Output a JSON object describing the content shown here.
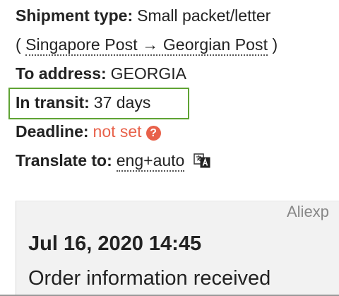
{
  "shipment": {
    "type_label": "Shipment type:",
    "type_value": "Small packet/letter",
    "route_open": "(",
    "route_text": "Singapore Post → Georgian Post",
    "route_close": ")",
    "address_label": "To address:",
    "address_value": "GEORGIA",
    "transit_label": "In transit:",
    "transit_value": "37 days",
    "deadline_label": "Deadline:",
    "deadline_value": "not set",
    "help_glyph": "?",
    "translate_label": "Translate to:",
    "translate_value": "eng+auto"
  },
  "event": {
    "carrier": "Aliexp",
    "date": "Jul 16, 2020 14:45",
    "text": "Order information received"
  },
  "colors": {
    "highlight": "#5fa334",
    "not_set": "#e8614a"
  },
  "icons": [
    "help-icon",
    "translate-icon"
  ]
}
